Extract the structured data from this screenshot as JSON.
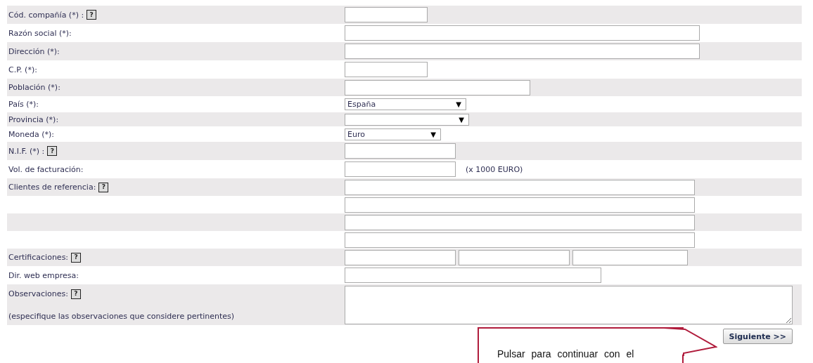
{
  "rows": [
    {
      "label": "Cód. compañía (*) :",
      "help": "?",
      "fields": [
        {
          "kind": "text"
        }
      ]
    },
    {
      "label": "Razón social (*):",
      "fields": [
        {
          "kind": "text"
        }
      ]
    },
    {
      "label": "Dirección (*):",
      "fields": [
        {
          "kind": "text"
        }
      ]
    },
    {
      "label": "C.P. (*):",
      "fields": [
        {
          "kind": "text"
        }
      ]
    },
    {
      "label": "Población (*):",
      "fields": [
        {
          "kind": "text"
        }
      ]
    },
    {
      "label": "País (*):",
      "fields": [
        {
          "kind": "select",
          "value": "España",
          "arrow": "▼"
        }
      ]
    },
    {
      "label": "Provincia (*):",
      "fields": [
        {
          "kind": "select",
          "arrow": "▼"
        }
      ]
    },
    {
      "label": "Moneda (*):",
      "fields": [
        {
          "kind": "select",
          "value": "Euro",
          "arrow": "▼"
        }
      ]
    },
    {
      "label": "N.I.F. (*) :",
      "help": "?",
      "fields": [
        {
          "kind": "text"
        }
      ]
    },
    {
      "label": "Vol. de facturación:",
      "fields": [
        {
          "kind": "text"
        }
      ],
      "note": "(x 1000 EURO)"
    },
    {
      "label": "Clientes de referencia:",
      "help": "?",
      "fields": [
        {
          "kind": "text"
        }
      ]
    },
    {
      "fields": [
        {
          "kind": "text"
        }
      ]
    },
    {
      "fields": [
        {
          "kind": "text"
        }
      ]
    },
    {
      "fields": [
        {
          "kind": "text"
        }
      ]
    },
    {
      "label": "Certificaciones:",
      "help": "?",
      "fields": [
        {
          "kind": "text"
        },
        {
          "kind": "text"
        },
        {
          "kind": "text"
        }
      ]
    },
    {
      "label": "Dir. web empresa:",
      "fields": [
        {
          "kind": "text"
        }
      ]
    },
    {
      "label": "Observaciones:",
      "help": "?",
      "hint": "(especifique las observaciones que considere pertinentes)",
      "fields": [
        {
          "kind": "textarea"
        }
      ]
    }
  ],
  "button": {
    "label": "Siguiente >>"
  },
  "callout": {
    "text": "Pulsar para continuar con el"
  }
}
